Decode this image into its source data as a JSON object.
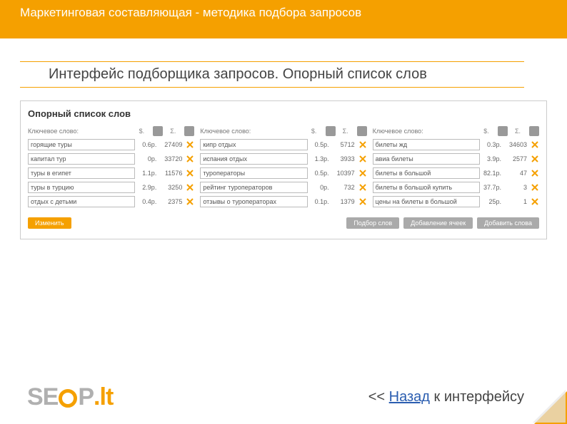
{
  "header": {
    "title": "Маркетинговая составляющая - методика подбора запросов"
  },
  "subtitle": "Интерфейс подборщика запросов. Опорный список слов",
  "panel": {
    "title": "Опорный список слов",
    "col_label": "Ключевое слово:",
    "col_price_head": "$.",
    "col_count_head": "Σ.",
    "columns": [
      {
        "rows": [
          {
            "kw": "горящие туры",
            "price": "0.6р.",
            "count": "27409"
          },
          {
            "kw": "капитал тур",
            "price": "0р.",
            "count": "33720"
          },
          {
            "kw": "туры в египет",
            "price": "1.1р.",
            "count": "11576"
          },
          {
            "kw": "туры в турцию",
            "price": "2.9р.",
            "count": "3250"
          },
          {
            "kw": "отдых с детьми",
            "price": "0.4р.",
            "count": "2375"
          }
        ]
      },
      {
        "rows": [
          {
            "kw": "кипр отдых",
            "price": "0.5р.",
            "count": "5712"
          },
          {
            "kw": "испания отдых",
            "price": "1.3р.",
            "count": "3933"
          },
          {
            "kw": "туроператоры",
            "price": "0.5р.",
            "count": "10397"
          },
          {
            "kw": "рейтинг туроператоров",
            "price": "0р.",
            "count": "732"
          },
          {
            "kw": "отзывы о туроператорах",
            "price": "0.1р.",
            "count": "1379"
          }
        ]
      },
      {
        "rows": [
          {
            "kw": "билеты жд",
            "price": "0.3р.",
            "count": "34603"
          },
          {
            "kw": "авиа билеты",
            "price": "3.9р.",
            "count": "2577"
          },
          {
            "kw": "билеты в большой",
            "price": "82.1р.",
            "count": "47"
          },
          {
            "kw": "билеты в большой купить",
            "price": "37.7р.",
            "count": "3"
          },
          {
            "kw": "цены на билеты в большой",
            "price": "25р.",
            "count": "1"
          }
        ]
      }
    ],
    "buttons": {
      "change": "Изменить",
      "pick": "Подбор слов",
      "addcell": "Добавление ячеек",
      "addword": "Добавить слова"
    }
  },
  "footer": {
    "back_prefix": "<< ",
    "back_link": "Назад",
    "back_suffix": " к интерфейсу"
  },
  "logo": {
    "se": "SE",
    "p": "P",
    "lt": ".lt"
  }
}
